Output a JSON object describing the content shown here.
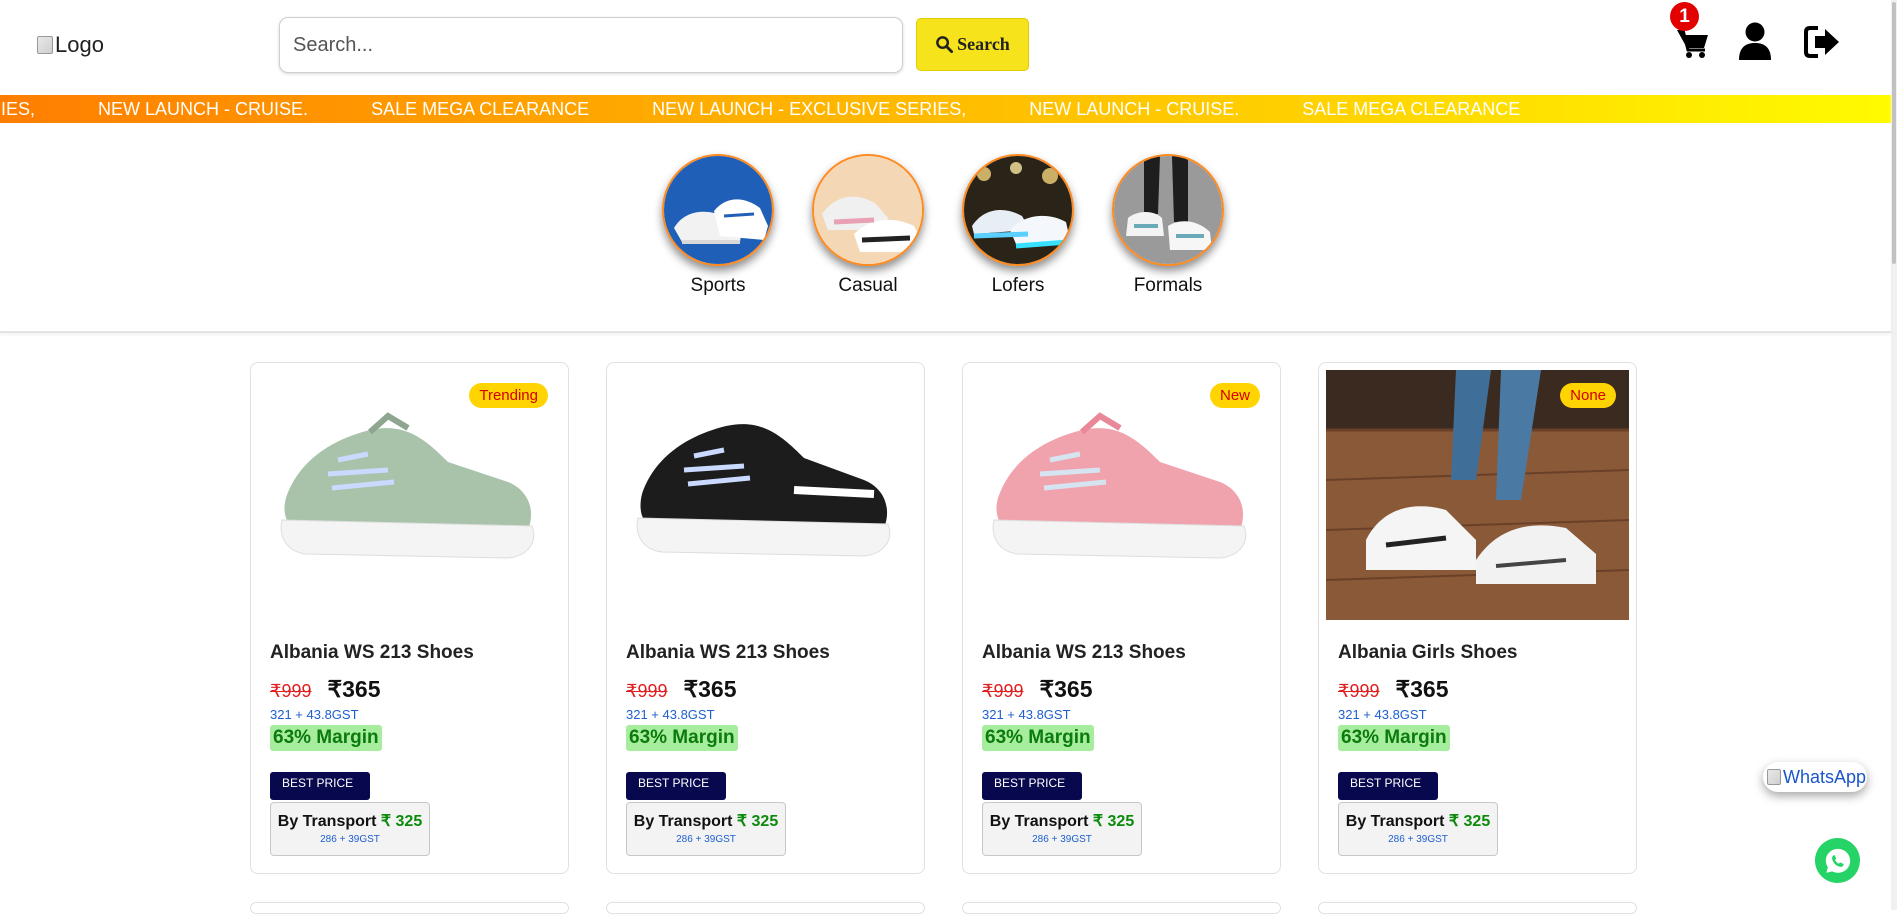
{
  "header": {
    "logo_alt": "Logo",
    "search_placeholder": "Search...",
    "search_button": "Search",
    "cart_count": "1",
    "cart_icon": "shopping-cart-icon",
    "user_icon": "user-icon",
    "logout_icon": "sign-out-icon"
  },
  "marquee": {
    "items": [
      "SIVE SERIES,",
      "NEW LAUNCH - CRUISE.",
      "SALE MEGA CLEARANCE",
      "NEW LAUNCH - EXCLUSIVE SERIES,",
      "NEW LAUNCH - CRUISE.",
      "SALE MEGA CLEARANCE"
    ]
  },
  "categories": [
    {
      "label": "Sports"
    },
    {
      "label": "Casual"
    },
    {
      "label": "Lofers"
    },
    {
      "label": "Formals"
    }
  ],
  "products": [
    {
      "badge": "Trending",
      "name": "Albania WS 213 Shoes",
      "old_price": "₹999",
      "price": "₹365",
      "gst": "321 + 43.8GST",
      "margin": "63% Margin",
      "best_label": "BEST PRICE",
      "transport_label": "By Transport",
      "transport_price": "₹ 325",
      "transport_sub": "286 + 39GST",
      "shoe_color": "#a9c3ab"
    },
    {
      "badge": "",
      "name": "Albania WS 213 Shoes",
      "old_price": "₹999",
      "price": "₹365",
      "gst": "321 + 43.8GST",
      "margin": "63% Margin",
      "best_label": "BEST PRICE",
      "transport_label": "By Transport",
      "transport_price": "₹ 325",
      "transport_sub": "286 + 39GST",
      "shoe_color": "#1c1c1c"
    },
    {
      "badge": "New",
      "name": "Albania WS 213 Shoes",
      "old_price": "₹999",
      "price": "₹365",
      "gst": "321 + 43.8GST",
      "margin": "63% Margin",
      "best_label": "BEST PRICE",
      "transport_label": "By Transport",
      "transport_price": "₹ 325",
      "transport_sub": "286 + 39GST",
      "shoe_color": "#f0a3ad"
    },
    {
      "badge": "None",
      "name": "Albania Girls Shoes",
      "old_price": "₹999",
      "price": "₹365",
      "gst": "321 + 43.8GST",
      "margin": "63% Margin",
      "best_label": "BEST PRICE",
      "transport_label": "By Transport",
      "transport_price": "₹ 325",
      "transport_sub": "286 + 39GST",
      "shoe_color": "#f2f2f2"
    }
  ],
  "whatsapp": {
    "alt": "WhatsApp",
    "icon": "whatsapp-icon"
  },
  "colors": {
    "accent_yellow": "#f7e31b",
    "marquee_start": "#ff7e00",
    "marquee_end": "#fffb00",
    "category_border": "#ff8a1f",
    "best_price_bg": "#08084e",
    "margin_bg": "#a6ee9e",
    "whatsapp_green": "#25d366"
  }
}
